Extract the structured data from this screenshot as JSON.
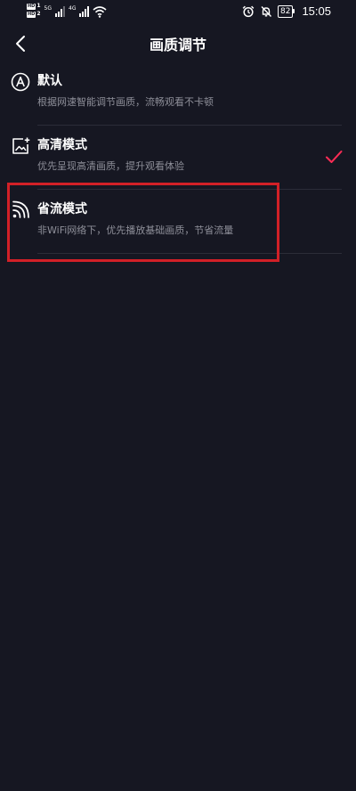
{
  "status_bar": {
    "hd_top": "HD",
    "hd_top_num": "1",
    "hd_bottom": "HD",
    "hd_bottom_num": "2",
    "net_1": "5G",
    "net_2": "4G",
    "battery": "82",
    "time": "15:05"
  },
  "nav": {
    "title": "画质调节"
  },
  "options": [
    {
      "title": "默认",
      "desc": "根据网速智能调节画质，流畅观看不卡顿",
      "selected": false
    },
    {
      "title": "高清模式",
      "desc": "优先呈现高清画质，提升观看体验",
      "selected": true
    },
    {
      "title": "省流模式",
      "desc": "非WiFi网络下，优先播放基础画质，节省流量",
      "selected": false
    }
  ],
  "colors": {
    "background": "#161722",
    "accent_check": "#fe2c55",
    "highlight_border": "#d22027"
  }
}
